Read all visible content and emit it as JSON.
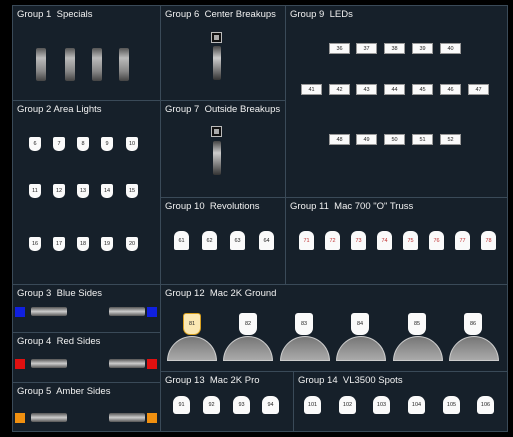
{
  "groups": [
    {
      "id": 1,
      "title": "Group 1  Specials"
    },
    {
      "id": 2,
      "title": "Group 2 Area Lights",
      "fixtures": [
        "6",
        "7",
        "8",
        "9",
        "10",
        "11",
        "12",
        "13",
        "14",
        "15",
        "16",
        "17",
        "18",
        "19",
        "20"
      ]
    },
    {
      "id": 3,
      "title": "Group 3  Blue Sides",
      "color": "#1020e0"
    },
    {
      "id": 4,
      "title": "Group 4  Red Sides",
      "color": "#e01010"
    },
    {
      "id": 5,
      "title": "Group 5  Amber Sides",
      "color": "#f09010"
    },
    {
      "id": 6,
      "title": "Group 6  Center Breakups"
    },
    {
      "id": 7,
      "title": "Group 7  Outside Breakups"
    },
    {
      "id": 9,
      "title": "Group 9  LEDs",
      "fixtures": [
        "36",
        "37",
        "38",
        "39",
        "40",
        "41",
        "42",
        "43",
        "44",
        "45",
        "46",
        "47",
        "48",
        "49",
        "50",
        "51",
        "52"
      ]
    },
    {
      "id": 10,
      "title": "Group 10  Revolutions",
      "fixtures": [
        "61",
        "62",
        "63",
        "64"
      ]
    },
    {
      "id": 11,
      "title": "Group 11  Mac 700 \"O\" Truss",
      "fixtures": [
        "71",
        "72",
        "73",
        "74",
        "75",
        "76",
        "77",
        "78"
      ]
    },
    {
      "id": 12,
      "title": "Group 12  Mac 2K Ground",
      "fixtures": [
        "81",
        "82",
        "83",
        "84",
        "85",
        "86"
      ],
      "selected": "81"
    },
    {
      "id": 13,
      "title": "Group 13  Mac 2K Pro",
      "fixtures": [
        "91",
        "92",
        "93",
        "94"
      ]
    },
    {
      "id": 14,
      "title": "Group 14  VL3500 Spots",
      "fixtures": [
        "101",
        "102",
        "103",
        "104",
        "105",
        "106"
      ]
    }
  ]
}
